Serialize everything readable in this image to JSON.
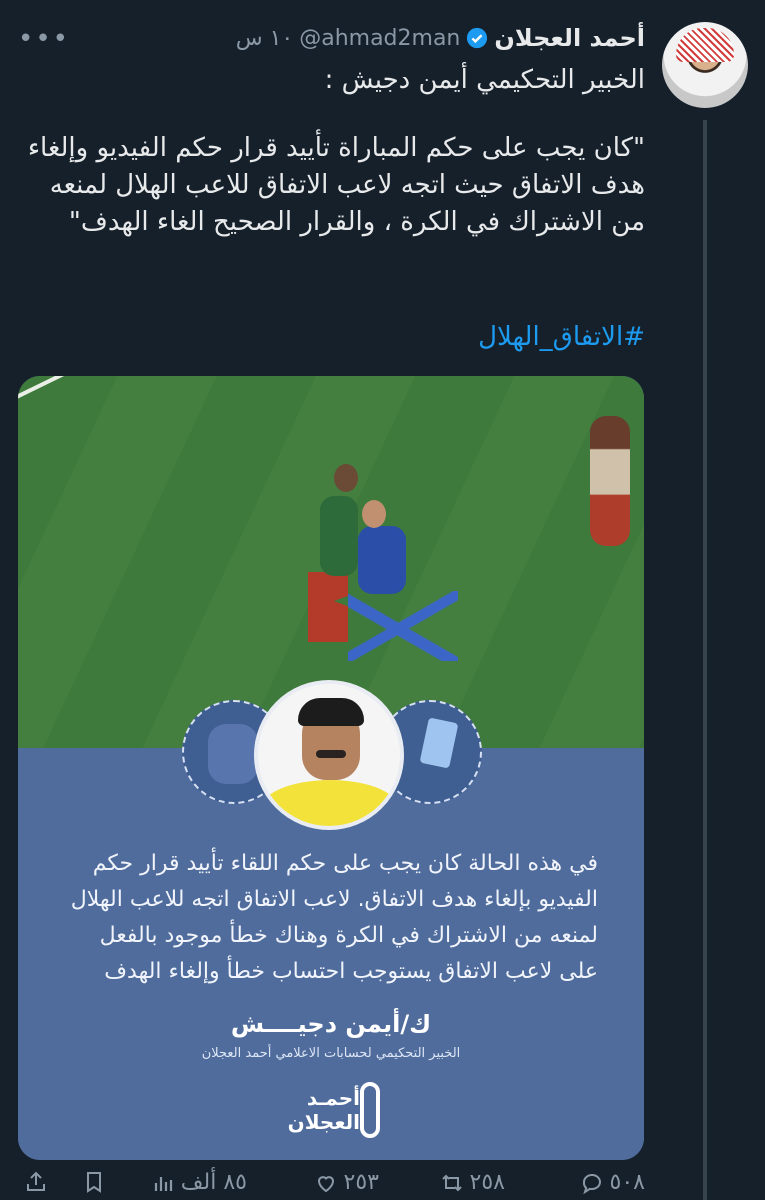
{
  "tweet": {
    "author_name": "أحمد العجلان",
    "handle": "@ahmad2man",
    "time": "١٠ س",
    "line1": "الخبير التحكيمي أيمن دجيش :",
    "body": "\"كان يجب على حكم المباراة تأييد قرار حكم الفيديو وإلغاء هدف الاتفاق حيث اتجه لاعب الاتفاق للاعب الهلال لمنعه من الاشتراك في الكرة ، والقرار الصحيح الغاء الهدف\"",
    "hashtag": "#الاتفاق_الهلال"
  },
  "card": {
    "quote": "في هذه الحالة كان يجب على حكم اللقاء تأييد قرار حكم الفيديو بإلغاء هدف الاتفاق. لاعب الاتفاق اتجه للاعب الهلال لمنعه من الاشتراك في الكرة وهناك خطأ موجود بالفعل على لاعب الاتفاق يستوجب احتساب خطأ وإلغاء الهدف",
    "signature": "ك/أيمن دجيــــش",
    "signature_sub": "الخبير التحكيمي لحسابات الاعلامي أحمد العجلان",
    "logo_text": "أحمـد العجلان"
  },
  "actions": {
    "replies": "٥٠٨",
    "retweets": "٢٥٨",
    "likes": "٢٥٣",
    "views": "٨٥ ألف"
  },
  "colors": {
    "background": "#15202b",
    "accent": "#1d9bf0",
    "muted": "#8b98a5",
    "card_blue": "#4f6c9d"
  },
  "icons": [
    "more-icon",
    "verified-icon",
    "reply-icon",
    "retweet-icon",
    "like-icon",
    "views-icon",
    "bookmark-icon",
    "share-icon"
  ]
}
